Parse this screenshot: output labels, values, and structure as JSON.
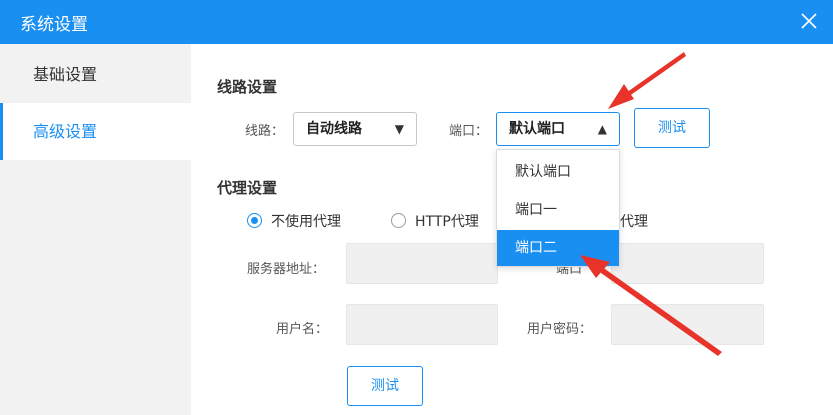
{
  "window": {
    "title": "系统设置",
    "close_icon": "close-icon"
  },
  "sidebar": {
    "items": [
      {
        "label": "基础设置",
        "active": false
      },
      {
        "label": "高级设置",
        "active": true
      }
    ]
  },
  "line_settings": {
    "section_title": "线路设置",
    "line_label": "线路：",
    "line_value": "自动线路",
    "port_label": "端口：",
    "port_value": "默认端口",
    "test_button": "测试",
    "port_options": [
      "默认端口",
      "端口一",
      "端口二"
    ],
    "highlighted_option": "端口二"
  },
  "proxy_settings": {
    "section_title": "代理设置",
    "options": [
      "不使用代理",
      "HTTP代理",
      "代理"
    ],
    "selected_option": "不使用代理",
    "server_label": "服务器地址：",
    "port_label_partial": "端口",
    "username_label": "用户名：",
    "password_label": "用户密码：",
    "test_button": "测试"
  },
  "annotations": {
    "arrow_color": "#e8332a"
  },
  "colors": {
    "accent": "#1a8ff2",
    "sidebar_bg": "#f2f2f2",
    "input_bg": "#f0f0f0"
  }
}
